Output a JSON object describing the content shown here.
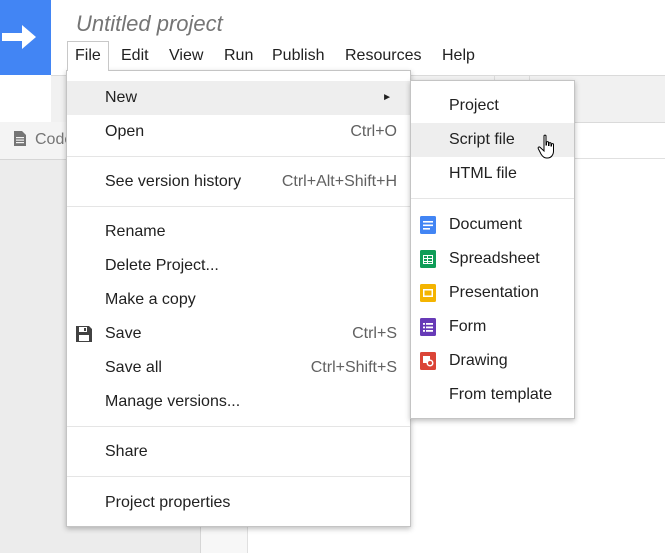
{
  "app": {
    "title": "Untitled project"
  },
  "menubar": {
    "items": [
      {
        "label": "File"
      },
      {
        "label": "Edit"
      },
      {
        "label": "View"
      },
      {
        "label": "Run"
      },
      {
        "label": "Publish"
      },
      {
        "label": "Resources"
      },
      {
        "label": "Help"
      }
    ]
  },
  "sidebar": {
    "tab_label": "Code"
  },
  "file_menu": {
    "new_label": "New",
    "open_label": "Open",
    "open_shortcut": "Ctrl+O",
    "version_history_label": "See version history",
    "version_history_shortcut": "Ctrl+Alt+Shift+H",
    "rename_label": "Rename",
    "delete_label": "Delete Project...",
    "copy_label": "Make a copy",
    "save_label": "Save",
    "save_shortcut": "Ctrl+S",
    "save_all_label": "Save all",
    "save_all_shortcut": "Ctrl+Shift+S",
    "manage_versions_label": "Manage versions...",
    "share_label": "Share",
    "properties_label": "Project properties"
  },
  "new_submenu": {
    "project_label": "Project",
    "script_file_label": "Script file",
    "html_file_label": "HTML file",
    "document_label": "Document",
    "spreadsheet_label": "Spreadsheet",
    "presentation_label": "Presentation",
    "form_label": "Form",
    "drawing_label": "Drawing",
    "template_label": "From template"
  },
  "colors": {
    "brand_blue": "#4285f4",
    "docs_blue": "#4285f4",
    "sheets_green": "#0f9d58",
    "slides_yellow": "#f4b400",
    "forms_purple": "#673ab7",
    "drawings_red": "#db4437"
  }
}
